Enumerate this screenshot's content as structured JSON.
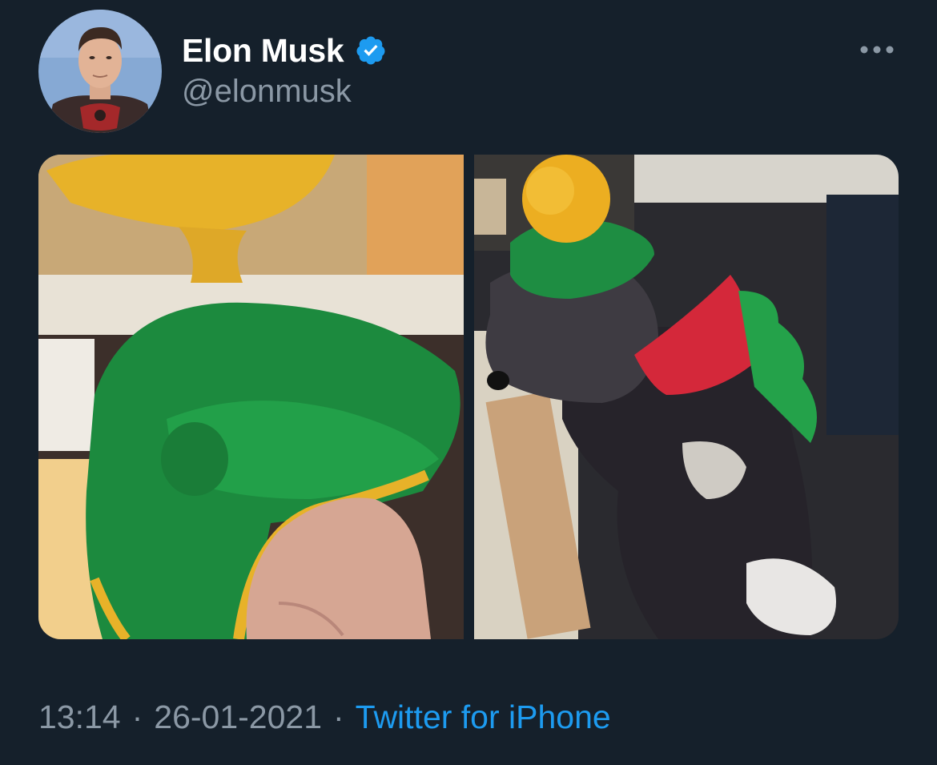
{
  "author": {
    "display_name": "Elon Musk",
    "handle": "@elonmusk",
    "verified": true,
    "avatar_icon": "profile-photo"
  },
  "menu": {
    "icon": "more-horizontal-icon"
  },
  "media": {
    "photos": [
      {
        "icon": "photo-crocheted-hat"
      },
      {
        "icon": "photo-dog-in-hat"
      }
    ]
  },
  "meta": {
    "time": "13:14",
    "separator": "·",
    "date": "26-01-2021",
    "source": "Twitter for iPhone"
  },
  "colors": {
    "background": "#15202b",
    "primary_text": "#ffffff",
    "secondary_text": "#8b98a5",
    "accent": "#1d9bf0"
  }
}
